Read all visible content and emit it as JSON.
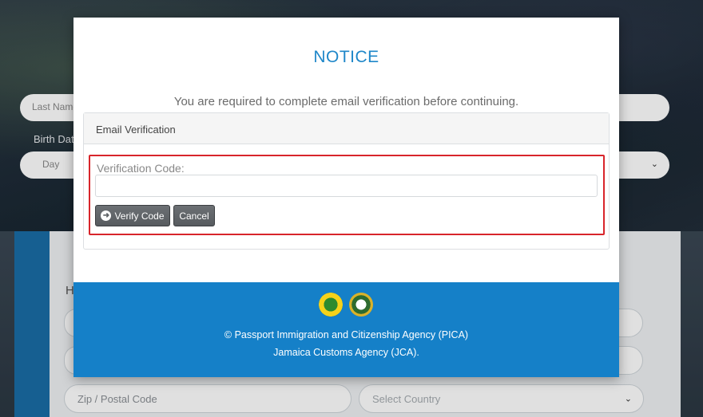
{
  "background": {
    "last_name_placeholder": "Last Name",
    "birth_label": "Birth Date",
    "day_placeholder": "Day",
    "section_heading": "H",
    "zip_placeholder": "Zip / Postal Code",
    "country_placeholder": "Select Country"
  },
  "modal": {
    "title": "NOTICE",
    "message": "You are required to complete email verification before continuing.",
    "panel_title": "Email Verification",
    "code_label": "Verification Code:",
    "code_value": "",
    "verify_button": "Verify Code",
    "cancel_button": "Cancel",
    "highlight_color": "#d8252b",
    "accent_color": "#1f87c9"
  },
  "footer": {
    "line1": "© Passport Immigration and Citizenship Agency (PICA)",
    "line2": "Jamaica Customs Agency (JCA).",
    "logos": [
      "pica-seal-icon",
      "jca-seal-icon"
    ],
    "background_color": "#1580c8"
  }
}
